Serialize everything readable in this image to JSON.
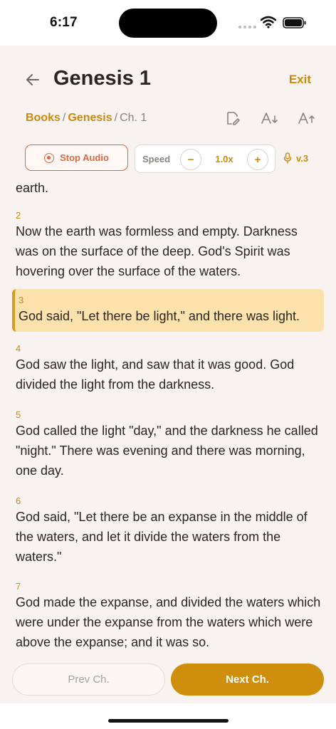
{
  "status": {
    "time": "6:17"
  },
  "header": {
    "title": "Genesis 1",
    "exit_label": "Exit"
  },
  "breadcrumb": {
    "books": "Books",
    "separator": "/",
    "book": "Genesis",
    "chapter": "Ch. 1"
  },
  "audio": {
    "stop_label": "Stop Audio",
    "speed_label": "Speed",
    "minus": "−",
    "plus": "+",
    "speed_value": "1.0x",
    "current_verse": "v.3"
  },
  "verses": [
    {
      "num": "",
      "text": "earth."
    },
    {
      "num": "2",
      "text": "Now the earth was formless and empty. Darkness was on the surface of the deep. God's Spirit was hovering over the surface of the waters."
    },
    {
      "num": "3",
      "text": "God said, \"Let there be light,\" and there was light."
    },
    {
      "num": "4",
      "text": "God saw the light, and saw that it was good. God divided the light from the darkness."
    },
    {
      "num": "5",
      "text": "God called the light \"day,\" and the darkness he called \"night.\" There was evening and there was morning, one day."
    },
    {
      "num": "6",
      "text": "God said, \"Let there be an expanse in the middle of the waters, and let it divide the waters from the waters.\""
    },
    {
      "num": "7",
      "text": "God made the expanse, and divided the waters which were under the expanse from the waters which were above the expanse; and it was so."
    }
  ],
  "nav": {
    "prev_label": "Prev Ch.",
    "next_label": "Next Ch."
  },
  "colors": {
    "accent": "#c98a12",
    "stop": "#d9683d",
    "highlight": "#fbe2ad",
    "background": "#f8f3f1"
  },
  "icons": [
    "back-arrow-icon",
    "edit-note-icon",
    "font-decrease-icon",
    "font-increase-icon",
    "stop-circle-icon",
    "microphone-icon",
    "wifi-icon",
    "battery-icon"
  ]
}
